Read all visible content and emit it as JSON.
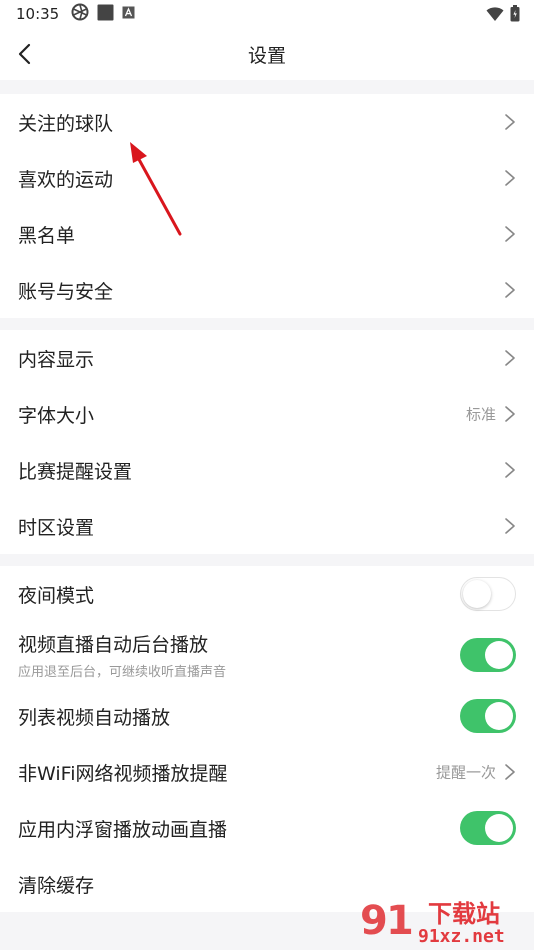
{
  "status_bar": {
    "time": "10:35",
    "icons": [
      "aperture-icon",
      "square-icon",
      "a-badge-icon"
    ],
    "right_icons": [
      "wifi-icon",
      "battery-icon"
    ]
  },
  "header": {
    "title": "设置",
    "back_icon": "chevron-left-icon"
  },
  "groups": [
    {
      "items": [
        {
          "label": "关注的球队",
          "type": "link"
        },
        {
          "label": "喜欢的运动",
          "type": "link"
        },
        {
          "label": "黑名单",
          "type": "link"
        },
        {
          "label": "账号与安全",
          "type": "link"
        }
      ]
    },
    {
      "items": [
        {
          "label": "内容显示",
          "type": "link"
        },
        {
          "label": "字体大小",
          "type": "link",
          "value": "标准"
        },
        {
          "label": "比赛提醒设置",
          "type": "link"
        },
        {
          "label": "时区设置",
          "type": "link"
        }
      ]
    },
    {
      "items": [
        {
          "label": "夜间模式",
          "type": "toggle",
          "on": false
        },
        {
          "label": "视频直播自动后台播放",
          "type": "toggle",
          "on": true,
          "sublabel": "应用退至后台，可继续收听直播声音"
        },
        {
          "label": "列表视频自动播放",
          "type": "toggle",
          "on": true
        },
        {
          "label": "非WiFi网络视频播放提醒",
          "type": "link",
          "value": "提醒一次"
        },
        {
          "label": "应用内浮窗播放动画直播",
          "type": "toggle",
          "on": true
        },
        {
          "label": "清除缓存",
          "type": "link"
        }
      ]
    }
  ],
  "colors": {
    "toggle_on": "#3fc36a",
    "annotation_arrow": "#d9161d"
  },
  "watermark": {
    "brand_text": "下载站",
    "domain_text": "91xz.net"
  }
}
